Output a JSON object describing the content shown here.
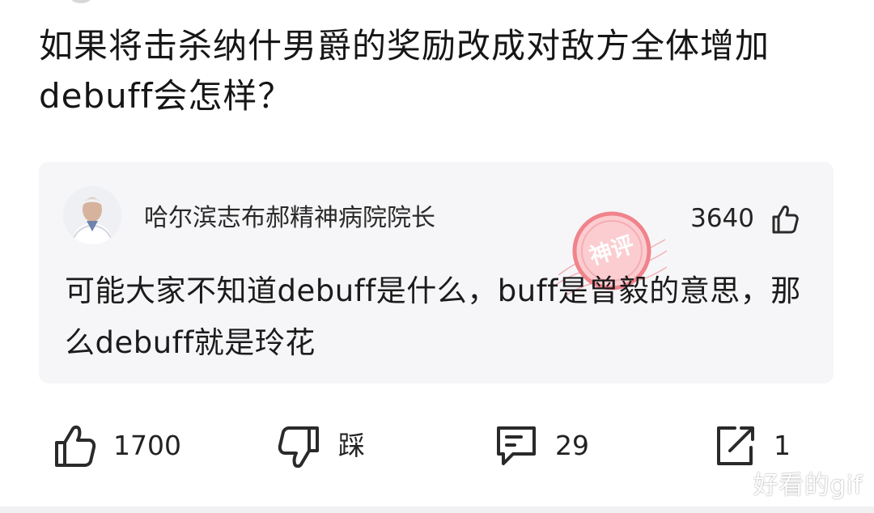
{
  "question": {
    "title": "如果将击杀纳什男爵的奖励改成对敌方全体增加debuff会怎样？"
  },
  "top_comment": {
    "author": "哈尔滨志布郝精神病院院长",
    "likes": "3640",
    "text": "可能大家不知道debuff是什么，buff是曾毅的意思，那么debuff就是玲花",
    "stamp_text": "神评",
    "icons": {
      "avatar": "avatar",
      "like": "thumbs-up-icon"
    }
  },
  "actions": {
    "like": {
      "icon": "thumbs-up-icon",
      "count": "1700"
    },
    "dislike": {
      "icon": "thumbs-down-icon",
      "label": "踩"
    },
    "comment": {
      "icon": "comment-icon",
      "count": "29"
    },
    "share": {
      "icon": "share-icon",
      "count": "1"
    }
  },
  "watermark": "好看的gif",
  "colors": {
    "background": "#ffffff",
    "card": "#f6f6f8",
    "text": "#1b1b1b",
    "stamp": "#ef6f79"
  }
}
